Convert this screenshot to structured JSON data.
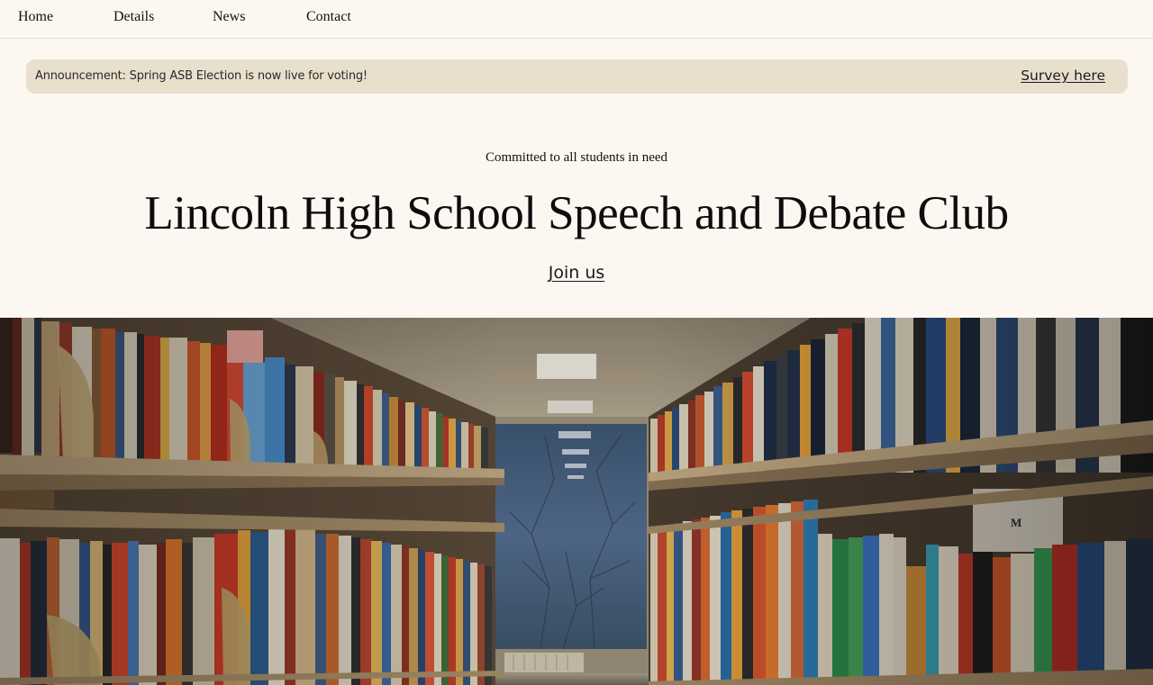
{
  "nav": {
    "items": [
      {
        "label": "Home"
      },
      {
        "label": "Details"
      },
      {
        "label": "News"
      },
      {
        "label": "Contact"
      }
    ]
  },
  "announcement": {
    "text": "Announcement: Spring ASB Election is now live for voting!",
    "link_label": "Survey here",
    "background": "#e9dfcd"
  },
  "hero": {
    "tagline": "Committed to all students in need",
    "title": "Lincoln High School Speech and Debate Club",
    "cta_label": "Join us"
  },
  "image": {
    "subject": "library-bookshelves-photo"
  },
  "colors": {
    "page_background": "#fcf7f1",
    "text": "#111111"
  }
}
